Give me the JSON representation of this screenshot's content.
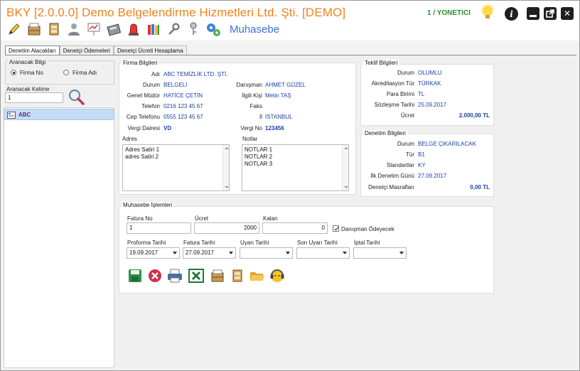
{
  "window": {
    "title": "BKY [2.0.0.0] Demo Belgelendirme Hizmetleri Ltd. Şti. [DEMO]",
    "user": "1 / YONETICI",
    "module": "Muhasebe",
    "controls": {
      "info": "i",
      "minimize": "▁",
      "restore": "⤢",
      "close": "✕"
    }
  },
  "toolbar": {
    "icons": [
      "pencil-icon",
      "cabinet-icon",
      "drawer-icon",
      "user-icon",
      "presentation-icon",
      "calculator-icon",
      "beacon-icon",
      "books-icon",
      "tools-icon",
      "key-icon",
      "gears-icon"
    ]
  },
  "tabs": [
    "Denetim Alacakları",
    "Denetçi Ödemeleri",
    "Denetçi Ücreti Hesaplama"
  ],
  "search": {
    "group_title": "Aranacak Bilgi",
    "option_1": "Firma No",
    "option_2": "Firma Adı",
    "selected": "Firma No",
    "keyword_label": "Aranacak Kelime",
    "keyword_value": "1"
  },
  "results": [
    {
      "name": "ABC"
    }
  ],
  "firma": {
    "title": "Firma Bilgileri",
    "labels": {
      "adi": "Adı",
      "durum": "Durum",
      "genel_mudur": "Genel Müdür",
      "telefon": "Telefon",
      "cep": "Cep Telefonu",
      "vergi_dairesi": "Vergi Dairesi",
      "danisman": "Danışman",
      "ilgili_kisi": "İlgili Kişi",
      "faks": "Faks",
      "il": "İl",
      "vergi_no": "Vergi No"
    },
    "values": {
      "adi": "ABC TEMİZLİK LTD. ŞTİ.",
      "durum": "BELGELİ",
      "genel_mudur": "HATİCE ÇETİN",
      "telefon": "0216 123 45 67",
      "cep": "0555 123 45 67",
      "vergi_dairesi": "VD",
      "danisman": "AHMET GÜZEL",
      "ilgili_kisi": "Metin TAŞ",
      "faks": "",
      "il": "İSTANBUL",
      "vergi_no": "123456"
    },
    "adres_label": "Adres",
    "adres": [
      "Adres Satiri 1",
      "adres Satiri 2"
    ],
    "notlar_label": "Notlar",
    "notlar": [
      "NOTLAR 1",
      "NOTLAR 2",
      "NOTLAR 3"
    ]
  },
  "teklif": {
    "title": "Teklif Bilgileri",
    "labels": {
      "durum": "Durum",
      "akreditasyon": "Akreditasyon Tür",
      "para": "Para Birimi",
      "tarih": "Sözleşme Tarihi",
      "ucret": "Ücret"
    },
    "values": {
      "durum": "OLUMLU",
      "akreditasyon": "TÜRKAK",
      "para": "TL",
      "tarih": "25.09.2017",
      "ucret": "2.000,00 TL"
    }
  },
  "denetim": {
    "title": "Denetim Bilgileri",
    "labels": {
      "durum": "Durum",
      "tur": "Tür",
      "standartlar": "Standartlar",
      "ilk_gun": "İlk Denetim Günü",
      "masraf": "Denetçi Masrafları"
    },
    "values": {
      "durum": "BELGE ÇIKARILACAK",
      "tur": "B1",
      "standartlar": "KY",
      "ilk_gun": "27.09.2017",
      "masraf": "0,00 TL"
    }
  },
  "muhasebe": {
    "title": "Muhasebe İşlemleri",
    "fatura_no_label": "Fatura No",
    "fatura_no": "1",
    "ucret_label": "Ücret",
    "ucret": "2000",
    "kalan_label": "Kalan",
    "kalan": "0",
    "danisman_odeyecek_label": "Danışman Ödeyecek",
    "danisman_odeyecek": true,
    "proforma_label": "Proforma Tarihi",
    "proforma": "19.09.2017",
    "fatura_tarihi_label": "Fatura Tarihi",
    "fatura_tarihi": "27.09.2017",
    "uyari_label": "Uyarı Tarihi",
    "uyari": "",
    "son_uyari_label": "Son Uyarı Tarihi",
    "son_uyari": "",
    "iptal_label": "İptal Tarihi",
    "iptal": ""
  },
  "actions": [
    "save-icon",
    "delete-icon",
    "print-icon",
    "excel-icon",
    "cabinet-icon",
    "drawer-icon",
    "folder-icon",
    "support-icon"
  ]
}
